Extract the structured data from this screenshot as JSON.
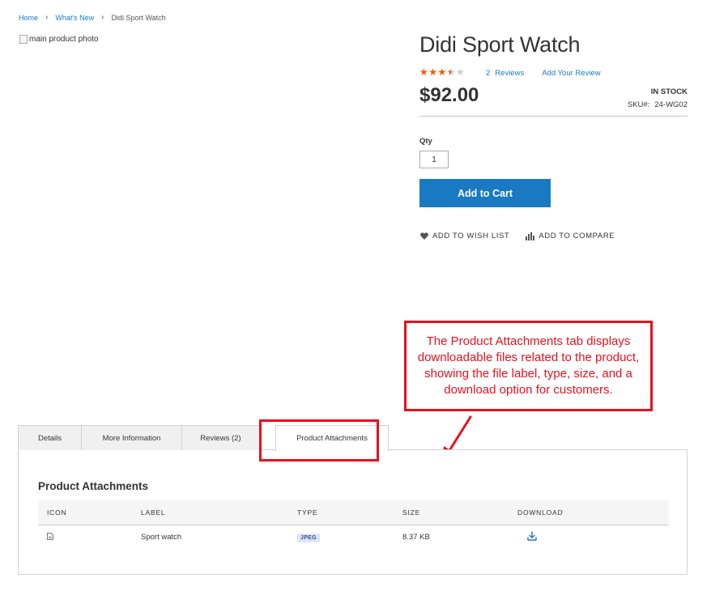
{
  "breadcrumb": {
    "items": [
      "Home",
      "What's New"
    ],
    "current": "Didi Sport Watch",
    "separator": "›"
  },
  "gallery": {
    "image_alt": "main product photo"
  },
  "product": {
    "name": "Didi Sport Watch",
    "rating_fraction": 0.65,
    "reviews_count": "2",
    "reviews_label": "Reviews",
    "add_review_label": "Add Your Review",
    "price": "$92.00",
    "stock_status": "IN STOCK",
    "sku_label": "SKU#:",
    "sku_value": "24-WG02",
    "qty_label": "Qty",
    "qty_value": "1",
    "add_to_cart_label": "Add to Cart",
    "wishlist_label": "ADD TO WISH LIST",
    "compare_label": "ADD TO COMPARE"
  },
  "callout": {
    "text": "The Product Attachments tab displays downloadable files related to the product, showing the file label, type, size, and a download option for customers."
  },
  "tabs": [
    "Details",
    "More Information",
    "Reviews (2)",
    "Product Attachments"
  ],
  "active_tab": "Product Attachments",
  "attachments": {
    "title": "Product Attachments",
    "columns": [
      "ICON",
      "LABEL",
      "TYPE",
      "SIZE",
      "DOWNLOAD"
    ],
    "rows": [
      {
        "icon": "file-icon",
        "label": "Sport watch",
        "type": "JPEG",
        "size": "8.37 KB",
        "download_icon": "download-icon"
      }
    ]
  },
  "colors": {
    "accent_blue": "#1979c3",
    "annotation_red": "#e8101d",
    "star_orange": "#ff5501"
  }
}
